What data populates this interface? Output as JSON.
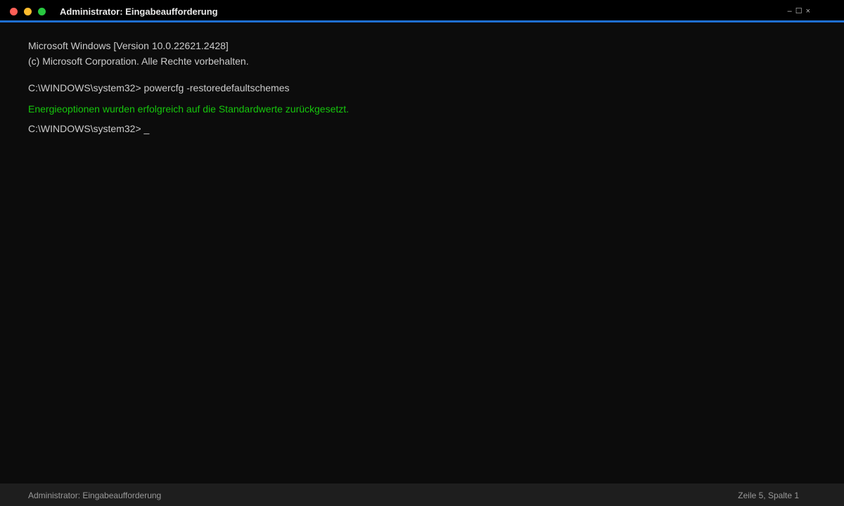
{
  "window": {
    "title": "Administrator: Eingabeaufforderung",
    "controls": {
      "minimize": "–",
      "maximize": "☐",
      "close": "×"
    }
  },
  "terminal": {
    "lines": [
      "Microsoft Windows [Version 10.0.22621.2428]",
      "(c) Microsoft Corporation. Alle Rechte vorbehalten.",
      "C:\\WINDOWS\\system32> powercfg -restoredefaultschemes",
      "Energieoptionen wurden erfolgreich auf die Standardwerte zurückgesetzt.",
      "C:\\WINDOWS\\system32> _"
    ]
  },
  "statusbar": {
    "left": "Administrator: Eingabeaufforderung",
    "right": "Zeile 5, Spalte 1"
  },
  "colors": {
    "titlebar_bg": "#000000",
    "accent": "#1f6fd1",
    "terminal_bg": "#0c0c0c",
    "text": "#cccccc",
    "success": "#16c60c",
    "statusbar_bg": "#1e1e1e"
  }
}
